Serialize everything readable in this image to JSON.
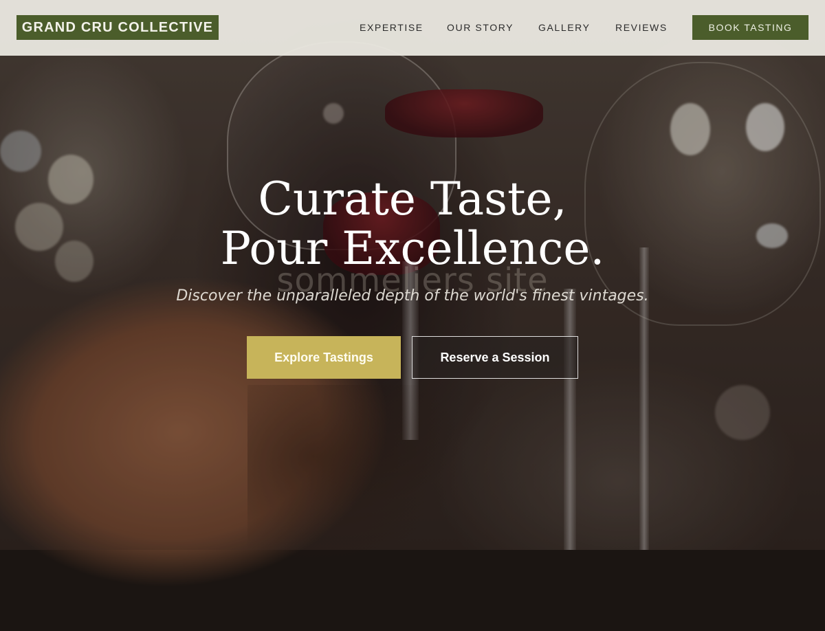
{
  "header": {
    "logo": "GRAND CRU COLLECTIVE",
    "nav": [
      "EXPERTISE",
      "OUR STORY",
      "GALLERY",
      "REVIEWS"
    ],
    "cta": "BOOK TASTING"
  },
  "hero": {
    "title_line1": "Curate Taste,",
    "title_line2": "Pour Excellence.",
    "watermark": "sommeliers site",
    "subtitle": "Discover the unparalleled depth of the world's finest vintages.",
    "primary_button": "Explore Tastings",
    "secondary_button": "Reserve a Session"
  },
  "colors": {
    "brand_green": "#4b5d2b",
    "accent_gold": "#c7b45a",
    "header_bg": "#eceae2"
  }
}
